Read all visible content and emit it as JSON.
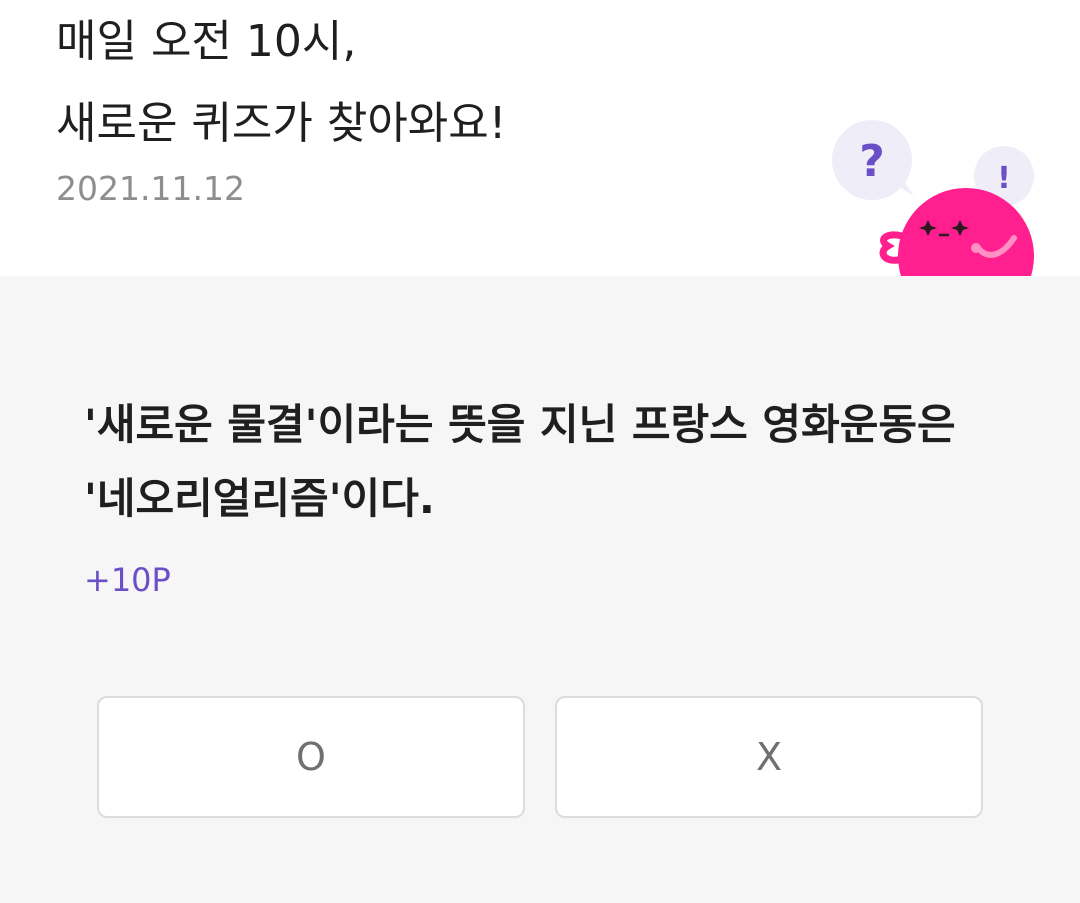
{
  "header": {
    "title_line1": "매일 오전 10시,",
    "title_line2": "새로운 퀴즈가 찾아와요!",
    "date": "2021.11.12"
  },
  "mascot": {
    "question_bubble_text": "?",
    "exclaim_bubble_text": "!",
    "body_color": "#ff1f8e",
    "bubble_color": "#efedf7",
    "accent_color": "#6b4fc7"
  },
  "quiz": {
    "question": "'새로운 물결'이라는 뜻을 지닌 프랑스 영화운동은 '네오리얼리즘'이다.",
    "points": "+10P",
    "options": {
      "o_label": "O",
      "x_label": "X"
    }
  }
}
